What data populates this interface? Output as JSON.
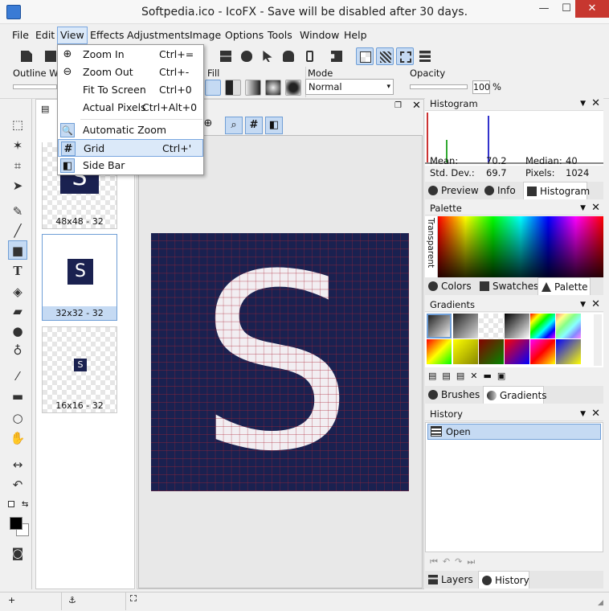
{
  "window": {
    "title": "Softpedia.ico - IcoFX - Save will be disabled after 30 days.",
    "min": "—",
    "max": "☐",
    "close": "✕"
  },
  "menubar": [
    "File",
    "Edit",
    "View",
    "Effects",
    "Adjustments",
    "Image",
    "Options",
    "Tools",
    "Window",
    "Help"
  ],
  "viewmenu": {
    "items": [
      {
        "label": "Zoom In",
        "shortcut": "Ctrl+=",
        "icon": "zoom-in-icon",
        "glyph": "⊕"
      },
      {
        "label": "Zoom Out",
        "shortcut": "Ctrl+-",
        "icon": "zoom-out-icon",
        "glyph": "⊖"
      },
      {
        "label": "Fit To Screen",
        "shortcut": "Ctrl+0",
        "icon": "",
        "glyph": ""
      },
      {
        "label": "Actual Pixels",
        "shortcut": "Ctrl+Alt+0",
        "icon": "",
        "glyph": ""
      },
      {
        "label": "Automatic Zoom",
        "shortcut": "",
        "icon": "magnifier-icon",
        "glyph": "🔍"
      },
      {
        "label": "Grid",
        "shortcut": "Ctrl+'",
        "icon": "grid-icon",
        "glyph": "#"
      },
      {
        "label": "Side Bar",
        "shortcut": "",
        "icon": "sidebar-icon",
        "glyph": "◧"
      }
    ]
  },
  "options": {
    "outline_label": "Outline Wid",
    "fill_label": "Fill",
    "mode_label": "Mode",
    "mode_value": "Normal",
    "opacity_label": "Opacity",
    "opacity_value": "100",
    "opacity_unit": "%"
  },
  "thumbnails": [
    {
      "label": "48x48 - 32",
      "letter": "S"
    },
    {
      "label": "32x32 - 32",
      "letter": "S"
    },
    {
      "label": "16x16 - 32",
      "letter": "S"
    }
  ],
  "canvas_letter": "S",
  "histogram": {
    "title": "Histogram",
    "mean_label": "Mean:",
    "mean": "70.2",
    "median_label": "Median:",
    "median": "40",
    "std_label": "Std. Dev.:",
    "std": "69.7",
    "pixels_label": "Pixels:",
    "pixels": "1024",
    "tabs": [
      "Preview",
      "Info",
      "Histogram"
    ]
  },
  "palette": {
    "title": "Palette",
    "transparent": "Transparent",
    "tabs": [
      "Colors",
      "Swatches",
      "Palette"
    ]
  },
  "gradients": {
    "title": "Gradients",
    "tabs": [
      "Brushes",
      "Gradients"
    ]
  },
  "history": {
    "title": "History",
    "entries": [
      "Open"
    ],
    "tabs": [
      "Layers",
      "History"
    ]
  },
  "status": {
    "anchor": "⚓"
  },
  "colors": {
    "accent": "#3b80d7",
    "selection": "#c5daf3",
    "canvas_bg": "#1a2150",
    "grid_line": "#aa2233"
  }
}
